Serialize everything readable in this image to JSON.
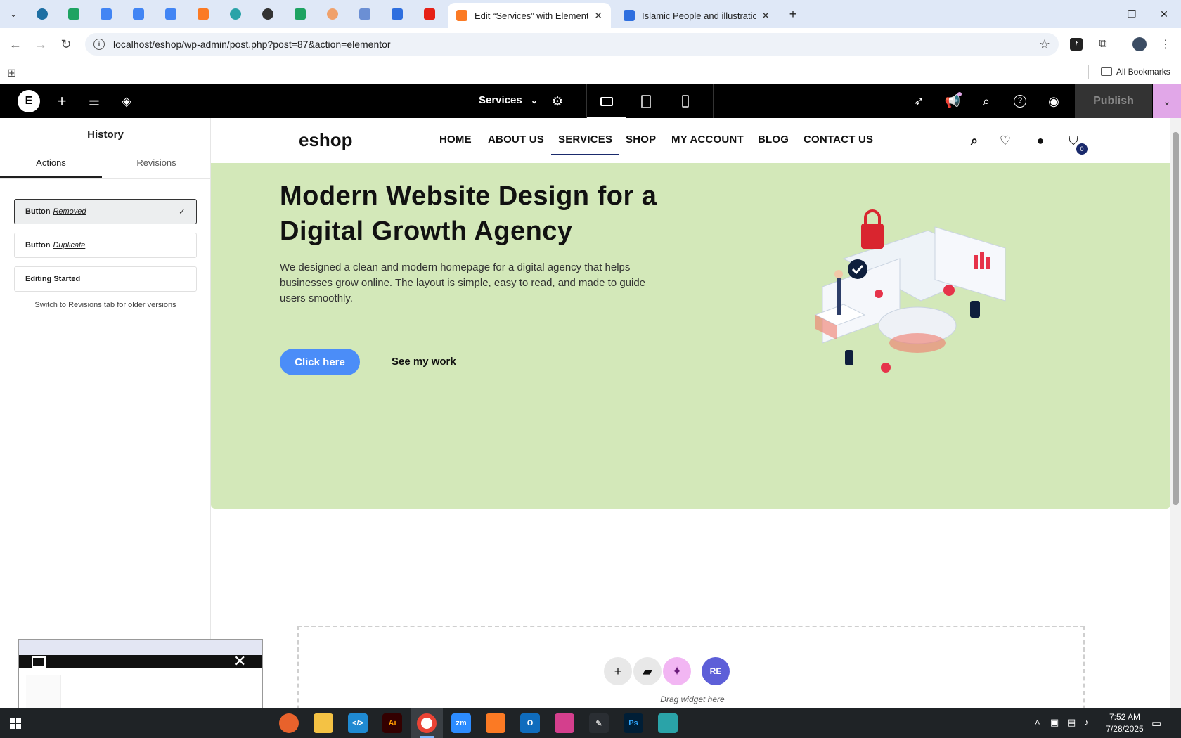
{
  "browser": {
    "active_tab_title": "Edit “Services” with Elementor",
    "second_tab_title": "Islamic People and illustration",
    "url": "localhost/eshop/wp-admin/post.php?post=87&action=elementor",
    "bookmarks_label": "All Bookmarks",
    "pinned_tab_icons": [
      "dropdown-icon",
      "wordpress-icon",
      "sheets-icon",
      "docs-icon",
      "docs-icon",
      "docs-icon",
      "xampp-icon",
      "app-icon",
      "chatgpt-icon",
      "sheets-icon",
      "app-icon",
      "app-icon",
      "forms-icon",
      "youtube-icon"
    ]
  },
  "elementor": {
    "page_name": "Services",
    "publish_label": "Publish"
  },
  "panel": {
    "title": "History",
    "tabs": [
      "Actions",
      "Revisions"
    ],
    "items": [
      {
        "action": "Button",
        "detail": "Removed",
        "current": true
      },
      {
        "action": "Button",
        "detail": "Duplicate",
        "current": false
      },
      {
        "action": "Editing Started",
        "detail": "",
        "current": false
      }
    ],
    "hint": "Switch to Revisions tab for older versions"
  },
  "site": {
    "logo": "eshop",
    "menu": [
      "HOME",
      "ABOUT US",
      "SERVICES",
      "SHOP",
      "MY ACCOUNT",
      "BLOG",
      "CONTACT US"
    ],
    "active_menu": "SERVICES",
    "cart_count": "0"
  },
  "hero": {
    "title": "Modern Website Design for a Digital Growth Agency",
    "text": "We designed a clean and modern homepage for a digital agency that helps businesses grow online. The layout is simple, easy to read, and made to guide users smoothly.",
    "primary_button": "Click here",
    "secondary_button": "See my work",
    "background": "#d3e8b9"
  },
  "dropzone": {
    "hint": "Drag widget here"
  },
  "taskbar": {
    "time": "7:52 AM",
    "date": "7/28/2025"
  },
  "colors": {
    "accent": "#4b8df8",
    "elementor_bar": "#000000",
    "publish_more": "#e1a7e8"
  }
}
